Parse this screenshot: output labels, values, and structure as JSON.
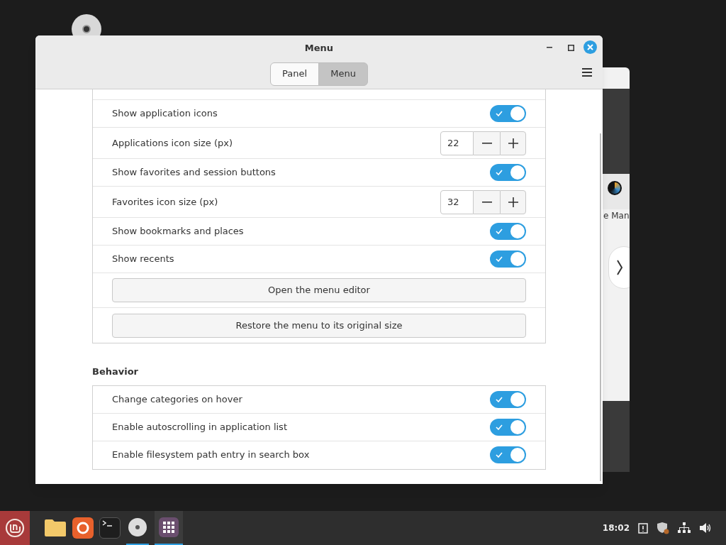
{
  "window": {
    "title": "Menu"
  },
  "tabs": [
    {
      "label": "Panel",
      "selected": false
    },
    {
      "label": "Menu",
      "selected": true
    }
  ],
  "sections": [
    {
      "rows": [
        {
          "kind": "toggle",
          "label": "Show application icons",
          "on": true
        },
        {
          "kind": "spin",
          "label": "Applications icon size (px)",
          "value": "22"
        },
        {
          "kind": "toggle",
          "label": "Show favorites and session buttons",
          "on": true
        },
        {
          "kind": "spin",
          "label": "Favorites icon size (px)",
          "value": "32"
        },
        {
          "kind": "toggle",
          "label": "Show bookmarks and places",
          "on": true
        },
        {
          "kind": "toggle",
          "label": "Show recents",
          "on": true
        },
        {
          "kind": "button",
          "label": "Open the menu editor"
        },
        {
          "kind": "button",
          "label": "Restore the menu to its original size"
        }
      ]
    },
    {
      "title": "Behavior",
      "rows": [
        {
          "kind": "toggle",
          "label": "Change categories on hover",
          "on": true
        },
        {
          "kind": "toggle",
          "label": "Enable autoscrolling in application list",
          "on": true
        },
        {
          "kind": "toggle",
          "label": "Enable filesystem path entry in search box",
          "on": true
        }
      ]
    }
  ],
  "background_window": {
    "partial_label": "e Man"
  },
  "taskbar": {
    "clock": "18:02"
  }
}
